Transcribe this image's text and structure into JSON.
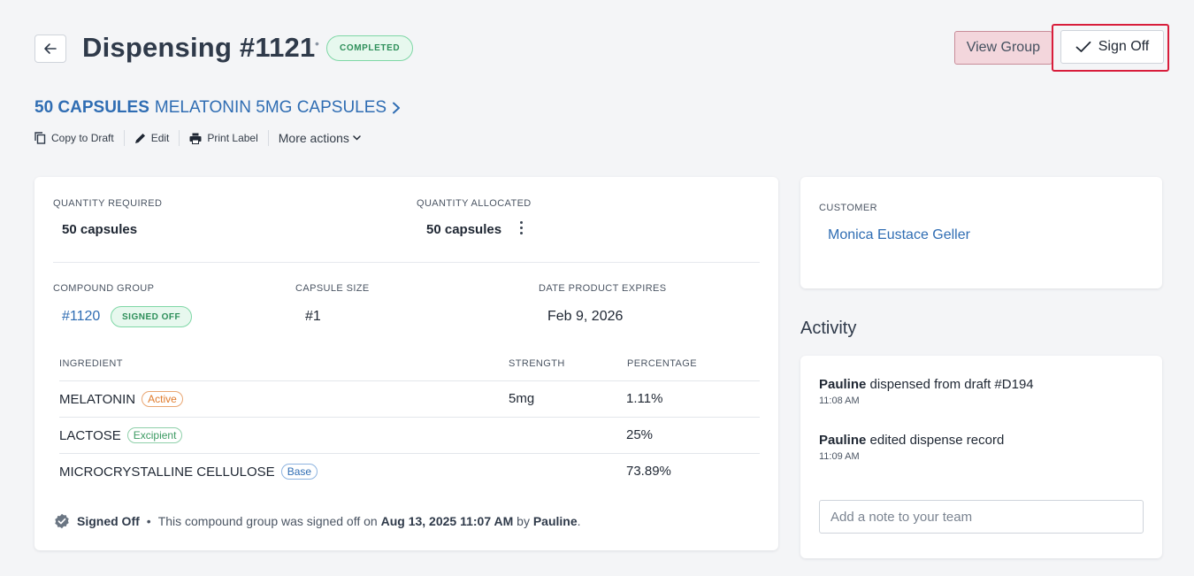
{
  "header": {
    "title": "Dispensing #1121",
    "status": "COMPLETED",
    "view_group_label": "View Group",
    "sign_off_label": "Sign Off"
  },
  "product": {
    "quantity": "50 CAPSULES",
    "name": "MELATONIN 5MG CAPSULES"
  },
  "actions": {
    "copy_to_draft": "Copy to Draft",
    "edit": "Edit",
    "print_label": "Print Label",
    "more_actions": "More actions"
  },
  "quantities": {
    "required_label": "QUANTITY REQUIRED",
    "required_value": "50 capsules",
    "allocated_label": "QUANTITY ALLOCATED",
    "allocated_value": "50 capsules"
  },
  "compound": {
    "group_label": "COMPOUND GROUP",
    "group_value": "#1120",
    "group_status": "SIGNED OFF",
    "capsule_size_label": "CAPSULE SIZE",
    "capsule_size_value": "#1",
    "expires_label": "DATE PRODUCT EXPIRES",
    "expires_value": "Feb 9, 2026"
  },
  "ingredients": {
    "headers": {
      "ingredient": "INGREDIENT",
      "strength": "STRENGTH",
      "percentage": "PERCENTAGE"
    },
    "rows": [
      {
        "name": "MELATONIN",
        "tag": "Active",
        "strength": "5mg",
        "percentage": "1.11%"
      },
      {
        "name": "LACTOSE",
        "tag": "Excipient",
        "strength": "",
        "percentage": "25%"
      },
      {
        "name": "MICROCRYSTALLINE CELLULOSE",
        "tag": "Base",
        "strength": "",
        "percentage": "73.89%"
      }
    ]
  },
  "signoff": {
    "status": "Signed Off",
    "text_prefix": "This compound group was signed off on",
    "datetime": "Aug 13, 2025 11:07 AM",
    "by_word": "by",
    "user": "Pauline",
    "period": "."
  },
  "customer": {
    "label": "CUSTOMER",
    "name": "Monica Eustace Geller"
  },
  "activity": {
    "title": "Activity",
    "items": [
      {
        "user": "Pauline",
        "text": "dispensed from draft #D194",
        "time": "11:08 AM"
      },
      {
        "user": "Pauline",
        "text": "edited dispense record",
        "time": "11:09 AM"
      }
    ],
    "note_placeholder": "Add a note to your team"
  },
  "colors": {
    "link": "#2f6db3",
    "success": "#2e8f5a",
    "highlight": "#d81d3b",
    "view_group_bg": "#f3d6dc"
  }
}
